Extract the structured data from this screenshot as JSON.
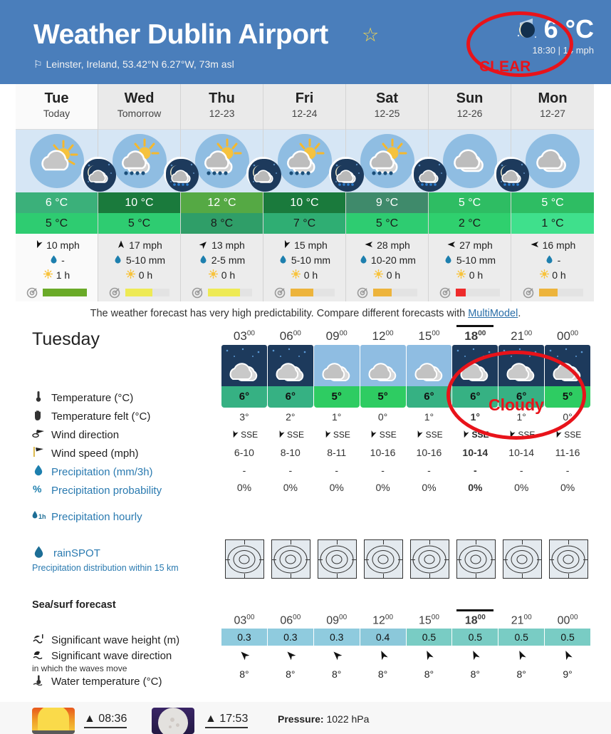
{
  "header": {
    "title": "Weather Dublin Airport",
    "favorite_icon": "star-icon",
    "subtitle": "Leinster, Ireland, 53.42°N 6.27°W, 73m asl",
    "current_temp": "6 °C",
    "current_meta": "18:30 | 14 mph",
    "current_icon": "moon-clear-icon",
    "bg_color": "#4a7ebb"
  },
  "annotations": [
    {
      "text": "CLEAR",
      "color": "#e8131a"
    },
    {
      "text": "Cloudy",
      "color": "#e8131a"
    }
  ],
  "days": [
    {
      "name": "Tue",
      "date": "Today",
      "icon": "sun-cloud-icon",
      "night_icon": "moon-cloud-icon",
      "tmax": "6 °C",
      "tmin": "5 °C",
      "tmax_color": "#3bb07a",
      "tmin_color": "#2ecc71",
      "wind": "10 mph",
      "wind_dir_icon": "arrow-sse-icon",
      "precip": "-",
      "sun": "1 h",
      "pred_pct": 100,
      "pred_color": "#6aaa28",
      "is_today": true
    },
    {
      "name": "Wed",
      "date": "Tomorrow",
      "icon": "sun-cloud-rain-icon",
      "night_icon": "moon-cloud-rain-icon",
      "tmax": "10 °C",
      "tmin": "5 °C",
      "tmax_color": "#1a7a3c",
      "tmin_color": "#2ecc71",
      "wind": "17 mph",
      "wind_dir_icon": "arrow-n-icon",
      "precip": "5-10 mm",
      "sun": "0 h",
      "pred_pct": 62,
      "pred_color": "#eeea55",
      "is_today": false
    },
    {
      "name": "Thu",
      "date": "12-23",
      "icon": "sun-cloud-rain-icon",
      "night_icon": "moon-cloud-icon",
      "tmax": "12 °C",
      "tmin": "8 °C",
      "tmax_color": "#55a944",
      "tmin_color": "#2f9e68",
      "wind": "13 mph",
      "wind_dir_icon": "arrow-ne-icon",
      "precip": "2-5 mm",
      "sun": "0 h",
      "pred_pct": 72,
      "pred_color": "#eeea55",
      "is_today": false
    },
    {
      "name": "Fri",
      "date": "12-24",
      "icon": "sun-cloud-rain-icon",
      "night_icon": "moon-cloud-rain-icon",
      "tmax": "10 °C",
      "tmin": "7 °C",
      "tmax_color": "#1a7a3c",
      "tmin_color": "#2fae73",
      "wind": "15 mph",
      "wind_dir_icon": "arrow-sse-icon",
      "precip": "5-10 mm",
      "sun": "0 h",
      "pred_pct": 52,
      "pred_color": "#edb43c",
      "is_today": false
    },
    {
      "name": "Sat",
      "date": "12-25",
      "icon": "sun-cloud-rain-icon",
      "night_icon": "cloud-rain-night-icon",
      "tmax": "9 °C",
      "tmin": "5 °C",
      "tmax_color": "#3f8a6b",
      "tmin_color": "#2ecc71",
      "wind": "28 mph",
      "wind_dir_icon": "arrow-w-icon",
      "precip": "10-20 mm",
      "sun": "0 h",
      "pred_pct": 42,
      "pred_color": "#edb43c",
      "is_today": false
    },
    {
      "name": "Sun",
      "date": "12-26",
      "icon": "cloud-icon",
      "night_icon": "moon-cloud-snow-icon",
      "tmax": "5 °C",
      "tmin": "2 °C",
      "tmax_color": "#2ebd63",
      "tmin_color": "#2fd06e",
      "wind": "27 mph",
      "wind_dir_icon": "arrow-w-icon",
      "precip": "5-10 mm",
      "sun": "0 h",
      "pred_pct": 22,
      "pred_color": "#ee2b2b",
      "is_today": false
    },
    {
      "name": "Mon",
      "date": "12-27",
      "icon": "cloud-icon",
      "night_icon": "",
      "tmax": "5 °C",
      "tmin": "1 °C",
      "tmax_color": "#2ebd63",
      "tmin_color": "#3fe08c",
      "wind": "16 mph",
      "wind_dir_icon": "arrow-w-icon",
      "precip": "-",
      "sun": "0 h",
      "pred_pct": 42,
      "pred_color": "#edb43c",
      "is_today": false
    }
  ],
  "multimodel_note": {
    "before": "The weather forecast has very high predictability. Compare different forecasts with ",
    "link": "MultiModel",
    "after": "."
  },
  "hourly": {
    "day_title": "Tuesday",
    "labels": [
      {
        "icon": "thermometer-icon",
        "text": "Temperature (°C)",
        "blue": false
      },
      {
        "icon": "hand-icon",
        "text": "Temperature felt (°C)",
        "blue": false
      },
      {
        "icon": "wind-direction-icon",
        "text": "Wind direction",
        "blue": false
      },
      {
        "icon": "wind-flag-icon",
        "text": "Wind speed (mph)",
        "blue": false
      },
      {
        "icon": "droplet-icon",
        "text": "Precipitation (mm/3h)",
        "blue": true
      },
      {
        "icon": "percent-droplet-icon",
        "text": "Precipitation probability",
        "blue": true
      }
    ],
    "precip_hourly_label": "Precipitation hourly",
    "precip_hourly_icon": "droplet-1h-icon",
    "rainspot_label": "rainSPOT",
    "rainspot_icon": "droplet-icon",
    "rainspot_sub": "Precipitation distribution within 15 km",
    "columns": [
      {
        "hour": "03",
        "hour_sup": "00",
        "sky": "night",
        "temp": "6°",
        "temp_color": "#36b183",
        "felt": "3°",
        "wind_dir": "SSE",
        "wind_speed": "6-10",
        "precip": "-",
        "prob": "0%",
        "now": false
      },
      {
        "hour": "06",
        "hour_sup": "00",
        "sky": "night",
        "temp": "6°",
        "temp_color": "#36b183",
        "felt": "2°",
        "wind_dir": "SSE",
        "wind_speed": "8-10",
        "precip": "-",
        "prob": "0%",
        "now": false
      },
      {
        "hour": "09",
        "hour_sup": "00",
        "sky": "day",
        "temp": "5°",
        "temp_color": "#2ecc62",
        "felt": "1°",
        "wind_dir": "SSE",
        "wind_speed": "8-11",
        "precip": "-",
        "prob": "0%",
        "now": false
      },
      {
        "hour": "12",
        "hour_sup": "00",
        "sky": "day",
        "temp": "5°",
        "temp_color": "#2ecc62",
        "felt": "0°",
        "wind_dir": "SSE",
        "wind_speed": "10-16",
        "precip": "-",
        "prob": "0%",
        "now": false
      },
      {
        "hour": "15",
        "hour_sup": "00",
        "sky": "day",
        "temp": "6°",
        "temp_color": "#36b183",
        "felt": "1°",
        "wind_dir": "SSE",
        "wind_speed": "10-16",
        "precip": "-",
        "prob": "0%",
        "now": false
      },
      {
        "hour": "18",
        "hour_sup": "00",
        "sky": "night",
        "temp": "6°",
        "temp_color": "#36b183",
        "felt": "1°",
        "wind_dir": "SSE",
        "wind_speed": "10-14",
        "precip": "-",
        "prob": "0%",
        "now": true
      },
      {
        "hour": "21",
        "hour_sup": "00",
        "sky": "night",
        "temp": "6°",
        "temp_color": "#36b183",
        "felt": "1°",
        "wind_dir": "SSE",
        "wind_speed": "10-14",
        "precip": "-",
        "prob": "0%",
        "now": false
      },
      {
        "hour": "00",
        "hour_sup": "00",
        "sky": "night",
        "temp": "5°",
        "temp_color": "#2ecc62",
        "felt": "0°",
        "wind_dir": "SSE",
        "wind_speed": "11-16",
        "precip": "-",
        "prob": "0%",
        "now": false
      }
    ]
  },
  "sea": {
    "title": "Sea/surf forecast",
    "labels": [
      {
        "icon": "wave-height-icon",
        "text": "Significant wave height (m)"
      },
      {
        "icon": "wave-direction-icon",
        "text": "Significant wave direction"
      },
      {
        "icon": "water-thermometer-icon",
        "text": "Water temperature (°C)"
      }
    ],
    "direction_sub": "in which the waves move",
    "columns": [
      {
        "hour": "03",
        "hour_sup": "00",
        "wave": "0.3",
        "wave_color": "#8fcbde",
        "dir_icon": "arrow-nw-icon",
        "wtemp": "8°",
        "now": false
      },
      {
        "hour": "06",
        "hour_sup": "00",
        "wave": "0.3",
        "wave_color": "#8fcbde",
        "dir_icon": "arrow-nw-icon",
        "wtemp": "8°",
        "now": false
      },
      {
        "hour": "09",
        "hour_sup": "00",
        "wave": "0.3",
        "wave_color": "#8fcbde",
        "dir_icon": "arrow-nw-icon",
        "wtemp": "8°",
        "now": false
      },
      {
        "hour": "12",
        "hour_sup": "00",
        "wave": "0.4",
        "wave_color": "#8bc8da",
        "dir_icon": "arrow-nnw-icon",
        "wtemp": "8°",
        "now": false
      },
      {
        "hour": "15",
        "hour_sup": "00",
        "wave": "0.5",
        "wave_color": "#79ccc4",
        "dir_icon": "arrow-nnw-icon",
        "wtemp": "8°",
        "now": false
      },
      {
        "hour": "18",
        "hour_sup": "00",
        "wave": "0.5",
        "wave_color": "#79ccc4",
        "dir_icon": "arrow-nnw-icon",
        "wtemp": "8°",
        "now": true
      },
      {
        "hour": "21",
        "hour_sup": "00",
        "wave": "0.5",
        "wave_color": "#79ccc4",
        "dir_icon": "arrow-nnw-icon",
        "wtemp": "8°",
        "now": false
      },
      {
        "hour": "00",
        "hour_sup": "00",
        "wave": "0.5",
        "wave_color": "#79ccc4",
        "dir_icon": "arrow-nnw-icon",
        "wtemp": "9°",
        "now": false
      }
    ]
  },
  "footer": {
    "sunrise_icon": "sunrise-icon",
    "sunrise_time": "08:36",
    "moonrise_icon": "moon-icon",
    "moonrise_time": "17:53",
    "pressure_label": "Pressure:",
    "pressure_value": "1022 hPa"
  }
}
